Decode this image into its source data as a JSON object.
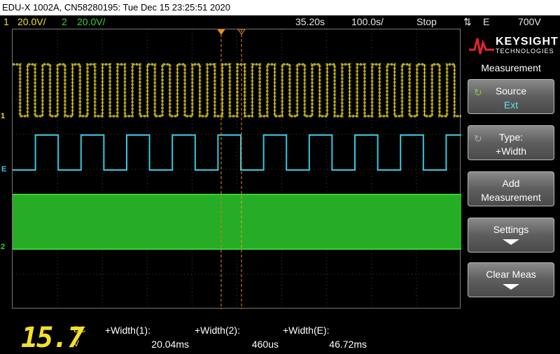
{
  "title_bar": "EDU-X 1002A, CN58280195: Tue Dec 15 23:25:51 2020",
  "status": {
    "ch1_num": "1",
    "ch1_scale": "20.0V/",
    "ch2_num": "2",
    "ch2_scale": "20.0V/",
    "delay": "35.20s",
    "timebase": "100.0s/",
    "run_state": "Stop",
    "trigger_icon": "trigger-arrows-icon",
    "trigger_source": "E",
    "trigger_level": "700V"
  },
  "markers": {
    "ch1": "1",
    "ext": "E",
    "ch2": "2"
  },
  "colors": {
    "ch1": "#f3e02a",
    "ch2": "#35d335",
    "ext": "#38c8e0",
    "cursor": "#f08a1c"
  },
  "logo": {
    "brand": "KEYSIGHT",
    "sub": "TECHNOLOGIES",
    "icon": "keysight-wave-icon"
  },
  "menu": {
    "title": "Measurement",
    "source_label": "Source",
    "source_value": "Ext",
    "type_label": "Type:",
    "type_value": "+Width",
    "add_line1": "Add",
    "add_line2": "Measurement",
    "settings_label": "Settings",
    "clear_label": "Clear Meas"
  },
  "bottom": {
    "counter": "15.7",
    "coupling_dc": "DC",
    "coupling_unit": "V",
    "measurements": [
      {
        "label": "+Width(1):",
        "value": "20.04ms"
      },
      {
        "label": "+Width(2):",
        "value": "460us"
      },
      {
        "label": "+Width(E):",
        "value": "46.72ms"
      }
    ]
  }
}
